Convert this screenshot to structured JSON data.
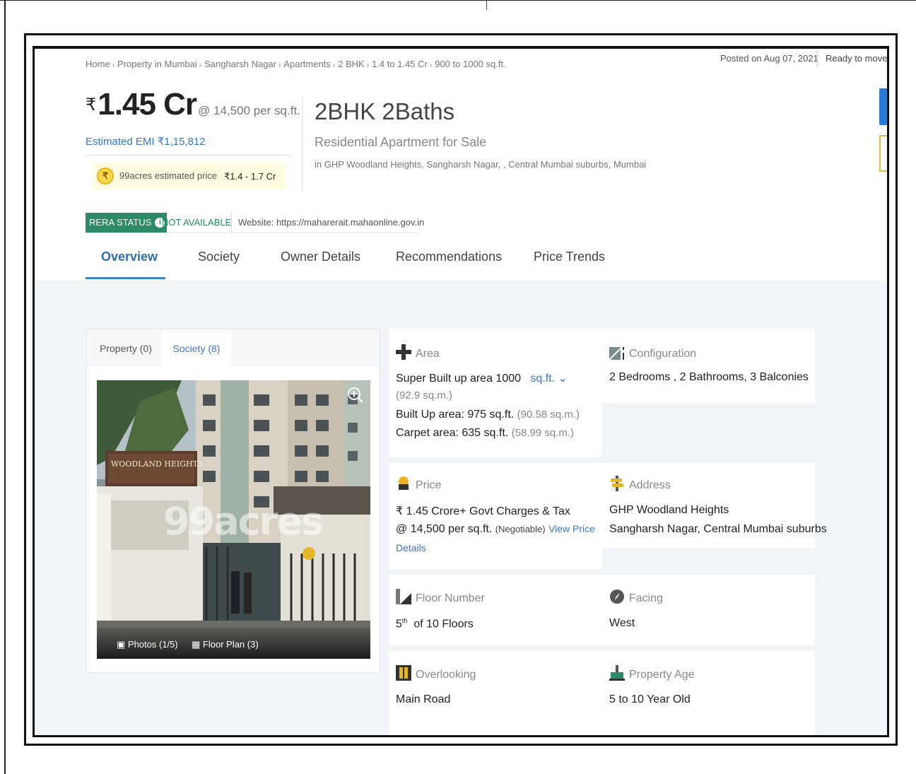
{
  "breadcrumb": [
    "Home",
    "Property in Mumbai",
    "Sangharsh Nagar",
    "Apartments",
    "2 BHK",
    "1.4 to 1.45 Cr",
    "900 to 1000 sq.ft."
  ],
  "header": {
    "posted": "Posted on Aug 07, 2021",
    "status": "Ready to move"
  },
  "price": {
    "currency": "₹",
    "amount": "1.45 Cr",
    "per_sqft": "@ 14,500 per sq.ft.",
    "emi": "Estimated EMI ₹1,15,812",
    "estimate_label": "99acres estimated price",
    "estimate_range": "₹1.4 - 1.7 Cr"
  },
  "listing": {
    "title": "2BHK 2Baths",
    "subtitle": "Residential Apartment for Sale",
    "location": "in GHP Woodland Heights, Sangharsh Nagar, , Central Mumbai suburbs, Mumbai"
  },
  "rera": {
    "badge": "RERA STATUS",
    "status": "NOT AVAILABLE",
    "website": "Website: https://maharerait.mahaonline.gov.in"
  },
  "tabs": [
    "Overview",
    "Society",
    "Owner Details",
    "Recommendations",
    "Price Trends"
  ],
  "photos": {
    "tab_property": "Property (0)",
    "tab_society": "Society (8)",
    "photos_label": "Photos (1/5)",
    "floorplan_label": "Floor Plan (3)",
    "watermark": "99acres",
    "sign_text": "WOODLAND HEIGHTS"
  },
  "details": {
    "area": {
      "label": "Area",
      "super_built": "Super Built up area 1000",
      "unit": "sq.ft.",
      "super_built_sqm": "(92.9 sq.m.)",
      "built_up": "Built Up area: 975 sq.ft.",
      "built_up_sqm": "(90.58 sq.m.)",
      "carpet": "Carpet area: 635 sq.ft.",
      "carpet_sqm": "(58.99 sq.m.)"
    },
    "configuration": {
      "label": "Configuration",
      "value": "2 Bedrooms , 2 Bathrooms, 3 Balconies"
    },
    "price": {
      "label": "Price",
      "line1": "₹ 1.45 Crore+ Govt Charges & Tax",
      "line2": "@ 14,500 per sq.ft.",
      "negotiable": "(Negotiable)",
      "link1": "View Price",
      "link2": "Details"
    },
    "address": {
      "label": "Address",
      "line1": "GHP Woodland Heights",
      "line2": "Sangharsh Nagar, Central Mumbai suburbs"
    },
    "floor": {
      "label": "Floor Number",
      "floor": "5",
      "suffix": "th",
      "of": "of 10 Floors"
    },
    "facing": {
      "label": "Facing",
      "value": "West"
    },
    "overlooking": {
      "label": "Overlooking",
      "value": "Main Road"
    },
    "age": {
      "label": "Property Age",
      "value": "5 to 10 Year Old"
    }
  },
  "colors": {
    "accent_blue": "#3a78c9",
    "rera_green": "#2d8a66",
    "estimate_bg": "#fffce0",
    "content_bg": "#f1f4f9"
  }
}
